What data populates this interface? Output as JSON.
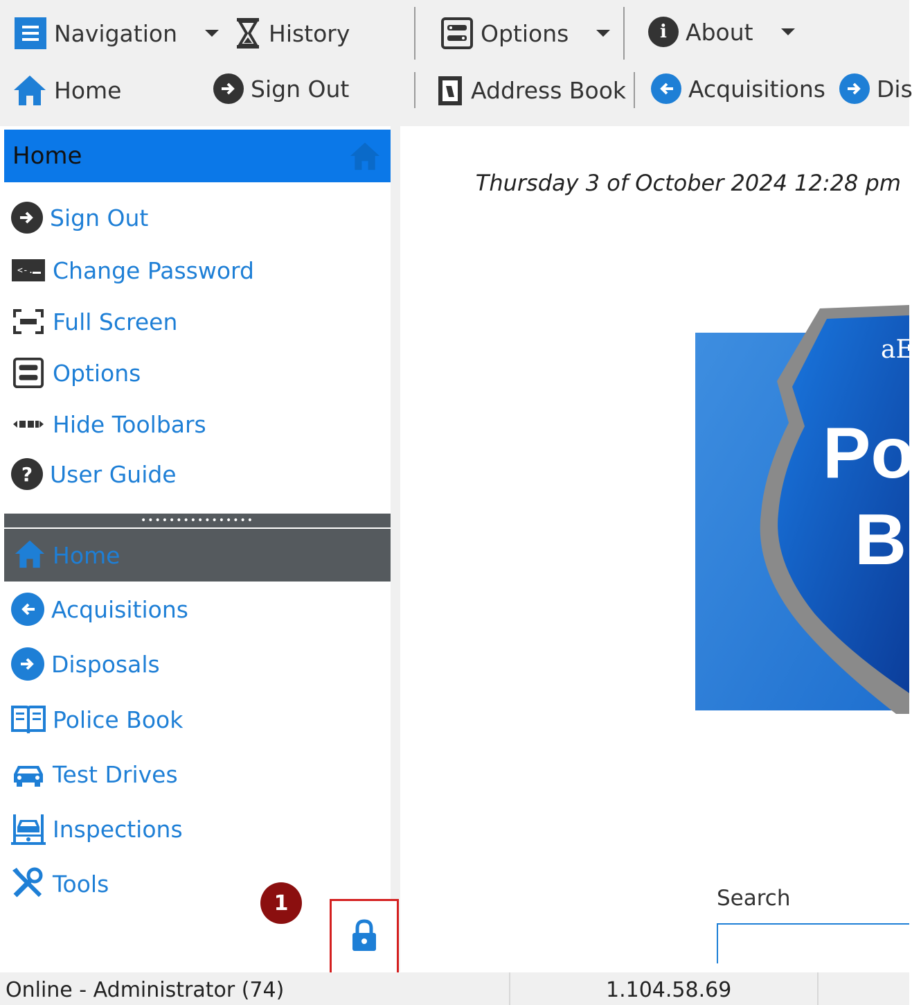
{
  "toolbar": {
    "row1": {
      "navigation": "Navigation",
      "history": "History",
      "options": "Options",
      "about": "About"
    },
    "row2": {
      "home": "Home",
      "sign_out": "Sign Out",
      "address_book": "Address Book",
      "acquisitions": "Acquisitions",
      "disposals_partial": "Dis"
    }
  },
  "sidebar": {
    "header": "Home",
    "items": [
      {
        "label": "Sign Out",
        "icon": "sign-out-icon"
      },
      {
        "label": "Change Password",
        "icon": "password-icon"
      },
      {
        "label": "Full Screen",
        "icon": "full-screen-icon"
      },
      {
        "label": "Options",
        "icon": "options-icon"
      },
      {
        "label": "Hide Toolbars",
        "icon": "hide-toolbars-icon"
      },
      {
        "label": "User Guide",
        "icon": "help-icon"
      }
    ],
    "section_header": "Home",
    "section_items": [
      {
        "label": "Acquisitions",
        "icon": "acquisitions-icon"
      },
      {
        "label": "Disposals",
        "icon": "disposals-icon"
      },
      {
        "label": "Police Book",
        "icon": "book-icon"
      },
      {
        "label": "Test Drives",
        "icon": "car-icon"
      },
      {
        "label": "Inspections",
        "icon": "lift-icon"
      },
      {
        "label": "Tools",
        "icon": "tools-icon"
      }
    ]
  },
  "main": {
    "datetime": "Thursday 3 of October 2024 12:28 pm",
    "logo_text": {
      "small": "aE",
      "line1": "Po",
      "line2": "B"
    },
    "search_label": "Search",
    "search_value": ""
  },
  "annotation": {
    "badge": "1"
  },
  "status": {
    "user": "Online - Administrator (74)",
    "ip": "1.104.58.69"
  },
  "colors": {
    "accent": "#1e7fd6",
    "header_blue": "#0b78e8",
    "section_gray": "#555a5e",
    "badge_red": "#8b0f0f",
    "highlight_red": "#d42020"
  }
}
